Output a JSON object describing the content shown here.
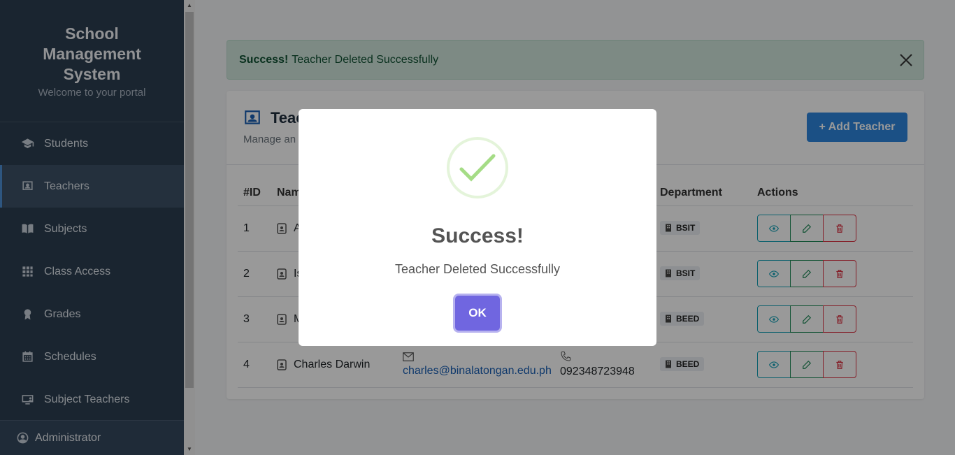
{
  "sidebar": {
    "title": "School Management System",
    "subtitle": "Welcome to your portal",
    "items": [
      {
        "label": "Students",
        "icon": "graduation-cap-icon"
      },
      {
        "label": "Teachers",
        "icon": "teacher-board-icon",
        "active": true
      },
      {
        "label": "Subjects",
        "icon": "book-icon"
      },
      {
        "label": "Class Access",
        "icon": "grid-icon"
      },
      {
        "label": "Grades",
        "icon": "award-icon"
      },
      {
        "label": "Schedules",
        "icon": "calendar-icon"
      },
      {
        "label": "Subject Teachers",
        "icon": "monitor-user-icon"
      }
    ],
    "user": "Administrator"
  },
  "alert": {
    "strong": "Success!",
    "message": "Teacher Deleted Successfully"
  },
  "card": {
    "title": "Teac",
    "subtitle": "Manage an",
    "add_button": "+ Add Teacher"
  },
  "table": {
    "headers": [
      "#ID",
      "Nam",
      "",
      "",
      "Department",
      "Actions"
    ],
    "rows": [
      {
        "id": "1",
        "name": "A",
        "email": "",
        "phone": "",
        "dept": "BSIT"
      },
      {
        "id": "2",
        "name": "Is",
        "email": "",
        "phone": "",
        "dept": "BSIT"
      },
      {
        "id": "3",
        "name": "M",
        "email": "",
        "phone": "",
        "dept": "BEED"
      },
      {
        "id": "4",
        "name": "Charles Darwin",
        "email": "charles@binalatongan.edu.ph",
        "phone": "092348723948",
        "dept": "BEED"
      }
    ]
  },
  "modal": {
    "title": "Success!",
    "text": "Teacher Deleted Successfully",
    "ok": "OK"
  },
  "colors": {
    "sidebar": "#2c3e50",
    "primary": "#2e86de",
    "success_green": "#a5dc86",
    "confirm": "#7066e0"
  }
}
